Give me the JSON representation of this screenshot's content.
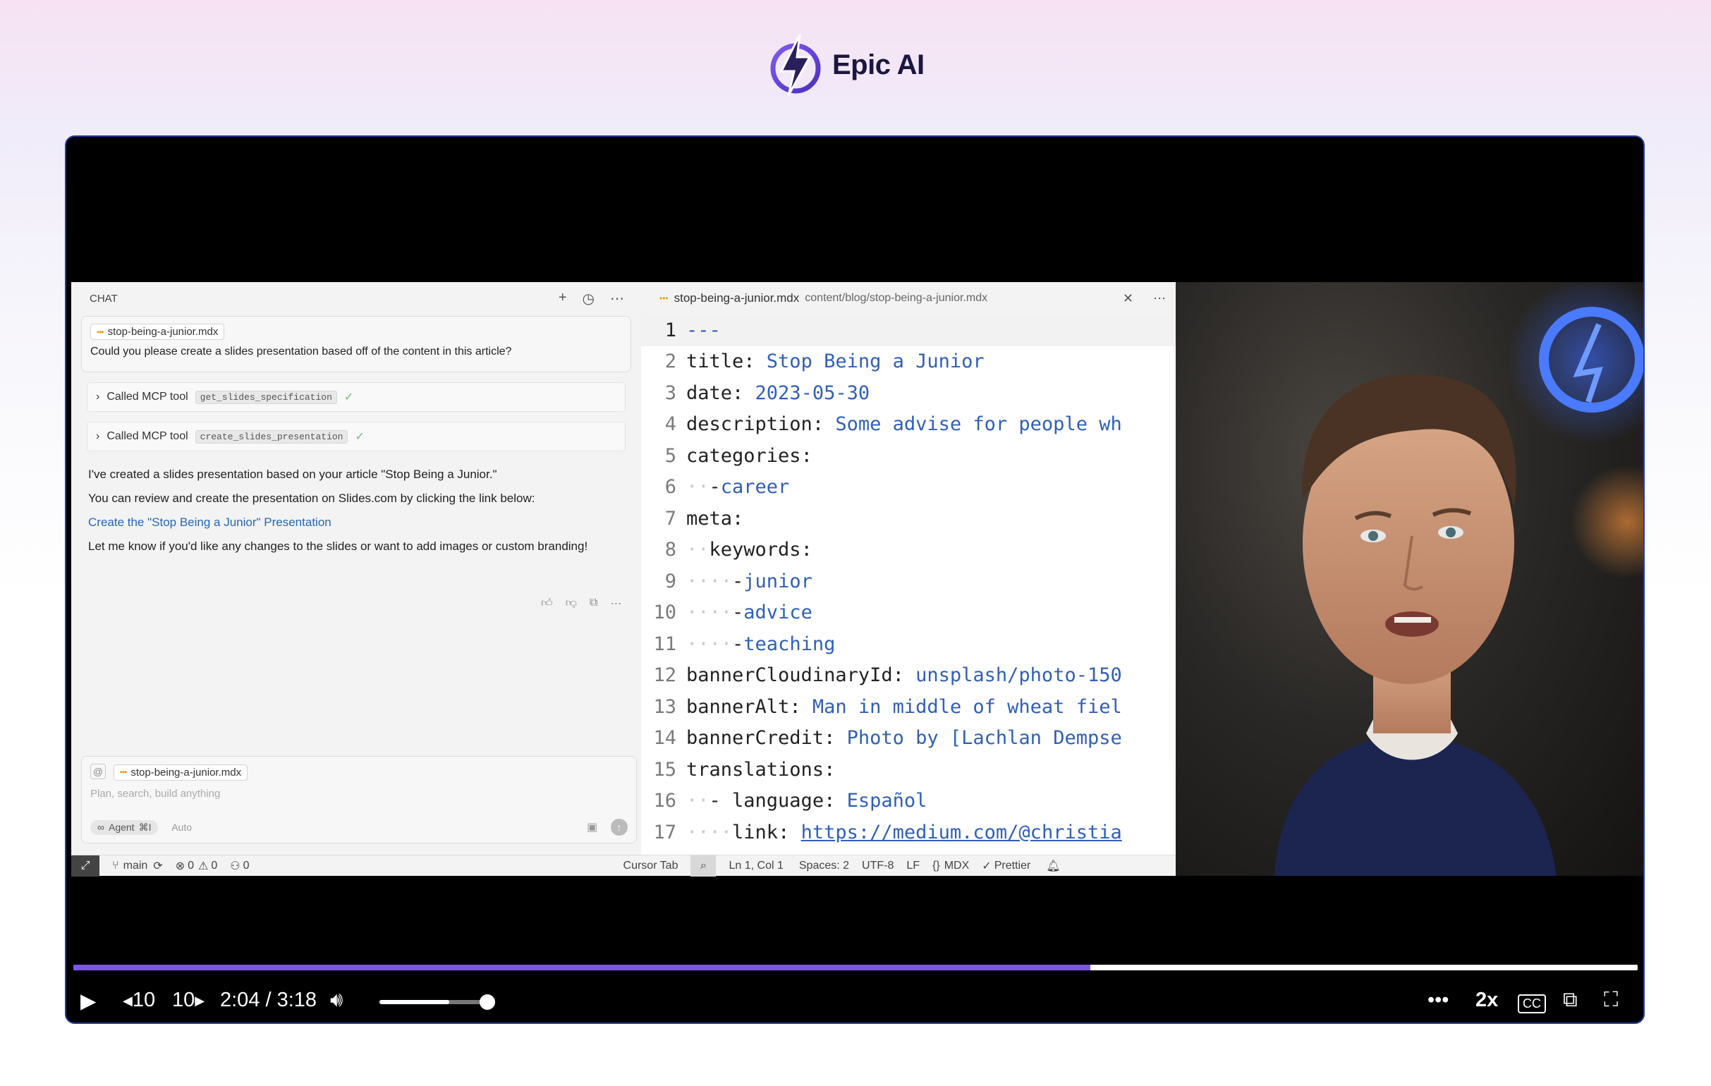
{
  "brand": {
    "title": "Epic AI"
  },
  "colors": {
    "accent": "#7a57e8",
    "link": "#2367b8",
    "value": "#2f5fb8"
  },
  "chat": {
    "header": "CHAT",
    "attached_file": "stop-being-a-junior.mdx",
    "user_message": "Could you please create a slides presentation based off of the content in this article?",
    "tool_calls": [
      {
        "label": "Called MCP tool",
        "tool": "get_slides_specification"
      },
      {
        "label": "Called MCP tool",
        "tool": "create_slides_presentation"
      }
    ],
    "answer": {
      "line1": "I've created a slides presentation based on your article \"Stop Being a Junior.\"",
      "line2": "You can review and create the presentation on Slides.com by clicking the link below:",
      "link": "Create the \"Stop Being a Junior\" Presentation",
      "line3": "Let me know if you'd like any changes to the slides or want to add images or custom branding!"
    },
    "composer": {
      "file": "stop-being-a-junior.mdx",
      "placeholder": "Plan, search, build anything",
      "agent": "Agent",
      "agent_shortcut": "⌘I",
      "auto": "Auto"
    }
  },
  "editor": {
    "filename": "stop-being-a-junior.mdx",
    "path": "content/blog/stop-being-a-junior.mdx",
    "lines": [
      {
        "n": "1",
        "indent": "",
        "key": "---",
        "sep": "",
        "val": ""
      },
      {
        "n": "2",
        "indent": "",
        "key": "title",
        "sep": ": ",
        "val": "Stop Being a Junior"
      },
      {
        "n": "3",
        "indent": "",
        "key": "date",
        "sep": ": ",
        "val": "2023-05-30"
      },
      {
        "n": "4",
        "indent": "",
        "key": "description",
        "sep": ": ",
        "val": "Some advise for people wh"
      },
      {
        "n": "5",
        "indent": "",
        "key": "categories",
        "sep": ":",
        "val": ""
      },
      {
        "n": "6",
        "indent": "··",
        "key": "- ",
        "sep": "",
        "val": "career"
      },
      {
        "n": "7",
        "indent": "",
        "key": "meta",
        "sep": ":",
        "val": ""
      },
      {
        "n": "8",
        "indent": "··",
        "key": "keywords",
        "sep": ":",
        "val": ""
      },
      {
        "n": "9",
        "indent": "····",
        "key": "- ",
        "sep": "",
        "val": "junior"
      },
      {
        "n": "10",
        "indent": "····",
        "key": "- ",
        "sep": "",
        "val": "advice"
      },
      {
        "n": "11",
        "indent": "····",
        "key": "- ",
        "sep": "",
        "val": "teaching"
      },
      {
        "n": "12",
        "indent": "",
        "key": "bannerCloudinaryId",
        "sep": ": ",
        "val": "unsplash/photo-150"
      },
      {
        "n": "13",
        "indent": "",
        "key": "bannerAlt",
        "sep": ": ",
        "val": "Man in middle of wheat fiel"
      },
      {
        "n": "14",
        "indent": "",
        "key": "bannerCredit",
        "sep": ": ",
        "val": "Photo by [Lachlan Dempse"
      },
      {
        "n": "15",
        "indent": "",
        "key": "translations",
        "sep": ":",
        "val": ""
      },
      {
        "n": "16",
        "indent": "··",
        "key": "- language",
        "sep": ": ",
        "val": "Español"
      },
      {
        "n": "17",
        "indent": "····",
        "key": "link",
        "sep": ": ",
        "val": "https://medium.com/@christia"
      }
    ]
  },
  "status_bar": {
    "branch": "main",
    "errors": "0",
    "warnings": "0",
    "ports": "0",
    "cursor_tab": "Cursor Tab",
    "position": "Ln 1, Col 1",
    "spaces": "Spaces: 2",
    "encoding": "UTF-8",
    "eol": "LF",
    "language": "MDX",
    "formatter": "Prettier"
  },
  "player": {
    "progress": 0.65,
    "time": "2:04 / 3:18",
    "skip_back": "10",
    "skip_forward": "10",
    "volume": 0.62,
    "speed": "2x",
    "cc": "CC"
  }
}
